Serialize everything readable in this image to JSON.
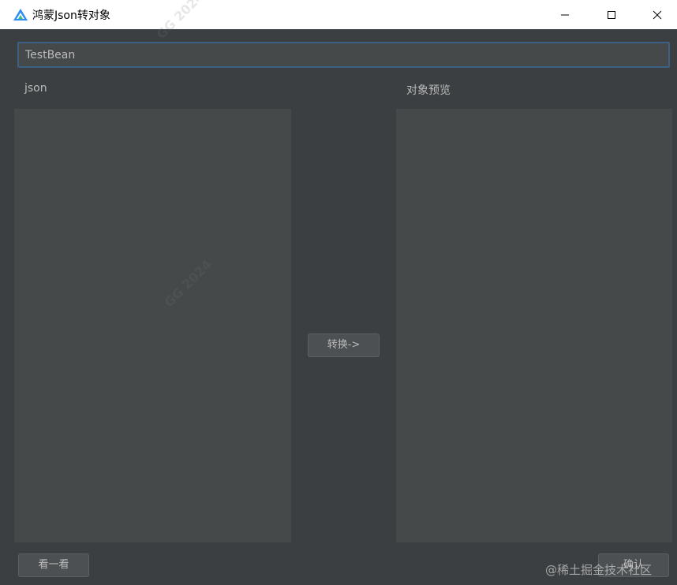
{
  "window": {
    "title": "鸿蒙Json转对象",
    "app_icon": "harmony-deveco-icon",
    "controls": [
      "minimize-icon",
      "maximize-icon",
      "close-icon"
    ]
  },
  "form": {
    "class_name_value": "TestBean",
    "json_label": "json",
    "preview_label": "对象预览",
    "json_text": "",
    "preview_text": "",
    "convert_button": "转换->",
    "look_button": "看一看",
    "confirm_button": "确认"
  },
  "overlay": {
    "watermark": "@稀土掘金技术社区",
    "ghost_text": "GG 2024"
  },
  "colors": {
    "background": "#3c3f41",
    "panel": "#45494a",
    "input_border": "#3d6185",
    "text": "#bbbbbb",
    "button": "#4c5052"
  }
}
